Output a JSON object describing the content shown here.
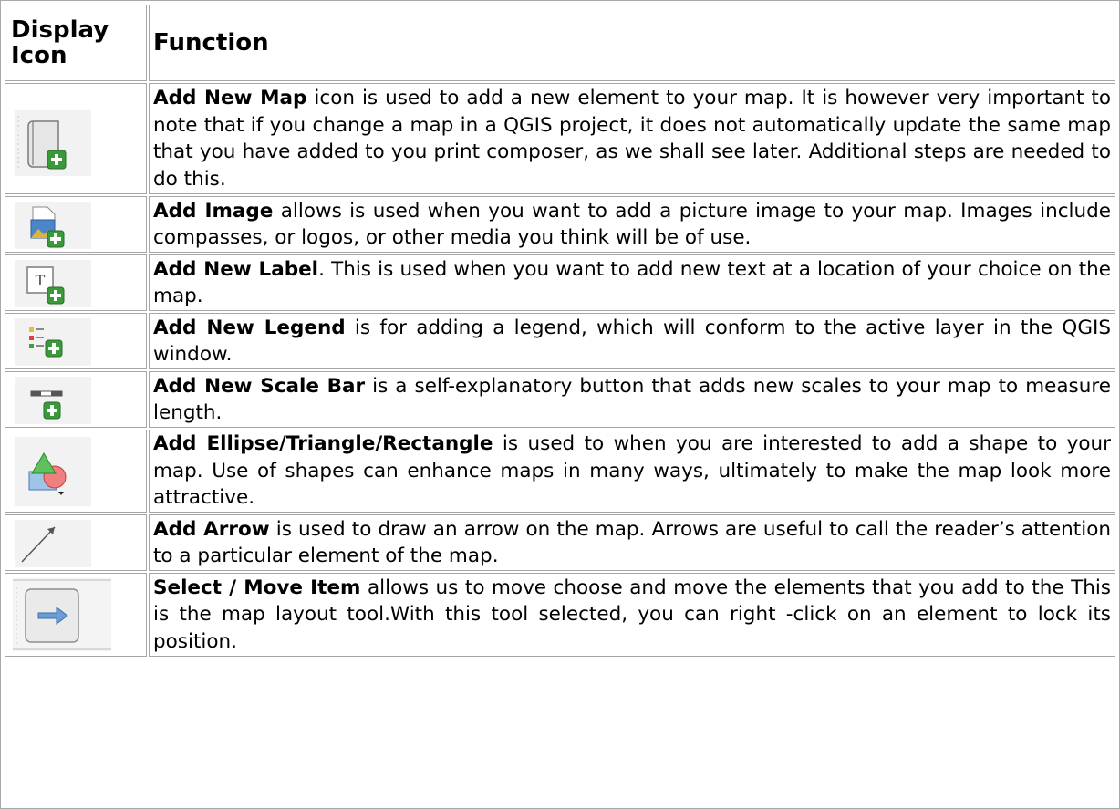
{
  "table": {
    "header_icon": "Display Icon",
    "header_function": "Function"
  },
  "rows": [
    {
      "icon": "add-map-icon",
      "name": "Add New Map",
      "text": " icon is used to add a new element to your map. It is however very important to note that if you change a map in a QGIS project, it does not automatically update the same map that you have added to you print composer, as we shall see later. Additional steps are needed to do this."
    },
    {
      "icon": "add-image-icon",
      "name": "Add Image",
      "text": " allows is used when you want to add a picture image to your map. Images include compasses, or logos, or other media you think will be of use."
    },
    {
      "icon": "add-label-icon",
      "name": "Add New Label",
      "text": ". This is used when you want to add new text at a location of your choice on the map."
    },
    {
      "icon": "add-legend-icon",
      "name": "Add New Legend",
      "text": " is for adding a legend, which will conform to the active layer in the QGIS window."
    },
    {
      "icon": "add-scale-bar-icon",
      "name": "Add New Scale Bar",
      "text": " is a self-explanatory button that adds new scales to your map to measure length."
    },
    {
      "icon": "add-shape-icon",
      "name": "Add Ellipse/Triangle/Rectangle",
      "text": " is used to when you are interested to add a shape to your map. Use of shapes can enhance maps in many ways, ultimately to make the map look more attractive."
    },
    {
      "icon": "add-arrow-icon",
      "name": "Add Arrow",
      "text": " is used to draw an arrow on the map. Arrows are useful to call the reader’s attention to a particular element of the map."
    },
    {
      "icon": "select-move-icon",
      "name": "Select / Move Item",
      "text": " allows us to move choose and move the elements that you add to the This is the map layout tool.With this tool selected, you can right -click on an element to lock its position."
    }
  ],
  "colors": {
    "plus_green": "#3a9a3a",
    "border": "#a6a6a6"
  }
}
